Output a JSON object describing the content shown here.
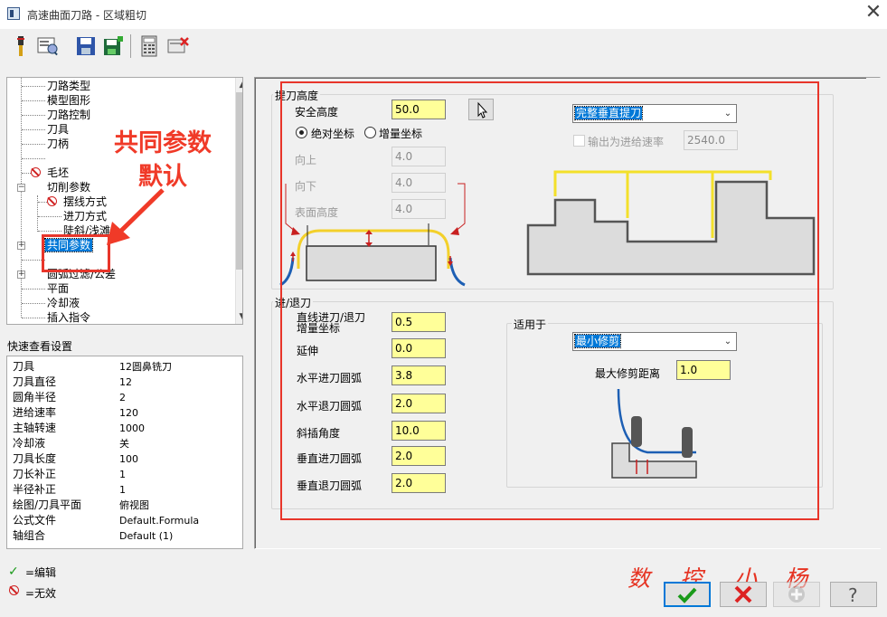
{
  "window": {
    "title": "高速曲面刀路 - 区域粗切",
    "close": "✕"
  },
  "toolbar": {
    "icons": [
      "tool-icon",
      "preview-icon",
      "save-icon",
      "save-all-icon",
      "calculator-icon",
      "delete-icon"
    ]
  },
  "tree": {
    "items": [
      {
        "label": "刀路类型"
      },
      {
        "label": "模型图形"
      },
      {
        "label": "刀路控制"
      },
      {
        "label": "刀具"
      },
      {
        "label": "刀柄"
      },
      {
        "label": "毛坯"
      },
      {
        "label": "切削参数"
      },
      {
        "label": "摆线方式"
      },
      {
        "label": "进刀方式"
      },
      {
        "label": "陡斜/浅滩"
      },
      {
        "label": "共同参数"
      },
      {
        "label": "圆弧过滤/公差"
      },
      {
        "label": "平面"
      },
      {
        "label": "冷却液"
      },
      {
        "label": "插入指令"
      }
    ]
  },
  "annotation": {
    "line1": "共同参数",
    "line2": "默认",
    "color": "#f03a28"
  },
  "quick_view": {
    "title": "快速查看设置",
    "rows": [
      {
        "key": "刀具",
        "value": "12圆鼻铣刀"
      },
      {
        "key": "刀具直径",
        "value": "12"
      },
      {
        "key": "圆角半径",
        "value": "2"
      },
      {
        "key": "进给速率",
        "value": "120"
      },
      {
        "key": "主轴转速",
        "value": "1000"
      },
      {
        "key": "冷却液",
        "value": "关"
      },
      {
        "key": "刀具长度",
        "value": "100"
      },
      {
        "key": "刀长补正",
        "value": "1"
      },
      {
        "key": "半径补正",
        "value": "1"
      },
      {
        "key": "绘图/刀具平面",
        "value": "俯视图"
      },
      {
        "key": "公式文件",
        "value": "Default.Formula"
      },
      {
        "key": "轴组合",
        "value": "Default (1)"
      }
    ]
  },
  "legend": {
    "edit": "=编辑",
    "invalid": "=无效"
  },
  "retract": {
    "title": "提刀高度",
    "safe_height_label": "安全高度",
    "safe_height_value": "50.0",
    "abs_label": "绝对坐标",
    "inc_label": "增量坐标",
    "up_label": "向上",
    "up_value": "4.0",
    "down_label": "向下",
    "down_value": "4.0",
    "surface_label": "表面高度",
    "surface_value": "4.0",
    "mode_value": "完整垂直提刀",
    "feed_check_label": "输出为进给速率",
    "feed_value": "2540.0"
  },
  "lead": {
    "title": "进/退刀",
    "line_incr_label": "直线进刀/退刀\n增量坐标",
    "line_incr_value": "0.5",
    "extend_label": "延伸",
    "extend_value": "0.0",
    "h_in_label": "水平进刀圆弧",
    "h_in_value": "3.8",
    "h_out_label": "水平退刀圆弧",
    "h_out_value": "2.0",
    "ramp_label": "斜插角度",
    "ramp_value": "10.0",
    "v_in_label": "垂直进刀圆弧",
    "v_in_value": "2.0",
    "v_out_label": "垂直退刀圆弧",
    "v_out_value": "2.0"
  },
  "apply": {
    "title": "适用于",
    "mode_value": "最小修剪",
    "max_trim_label": "最大修剪距离",
    "max_trim_value": "1.0"
  },
  "buttons": {
    "ok": "ok-check-icon",
    "cancel": "cancel-x-icon",
    "add": "add-plus-icon",
    "help": "help-question-icon"
  },
  "watermark": [
    "数",
    "控",
    "小",
    "杨"
  ]
}
